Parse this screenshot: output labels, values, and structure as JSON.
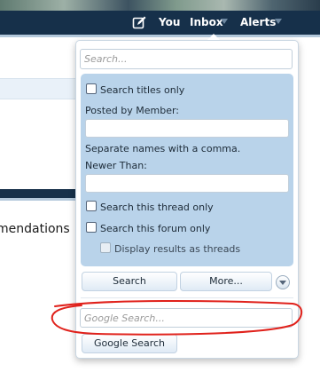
{
  "navbar": {
    "you_label": "You",
    "inbox_label": "Inbox",
    "alerts_label": "Alerts",
    "icons": [
      "edit-icon",
      "chevron-down-icon"
    ]
  },
  "page": {
    "partial_heading": "mendations"
  },
  "search_popup": {
    "search_placeholder": "Search...",
    "search_value": "",
    "search_titles_only_label": "Search titles only",
    "search_titles_only_checked": false,
    "posted_by_label": "Posted by Member:",
    "posted_by_value": "",
    "separate_hint": "Separate names with a comma.",
    "newer_than_label": "Newer Than:",
    "newer_than_value": "",
    "search_thread_label": "Search this thread only",
    "search_thread_checked": false,
    "search_forum_label": "Search this forum only",
    "search_forum_checked": false,
    "display_threads_label": "Display results as threads",
    "display_threads_checked": false,
    "search_button": "Search",
    "more_button": "More...",
    "google_placeholder": "Google Search...",
    "google_value": "",
    "google_button": "Google Search"
  },
  "colors": {
    "navbar": "#16304a",
    "panel": "#b9d3ea",
    "annotation": "#e0221c"
  }
}
